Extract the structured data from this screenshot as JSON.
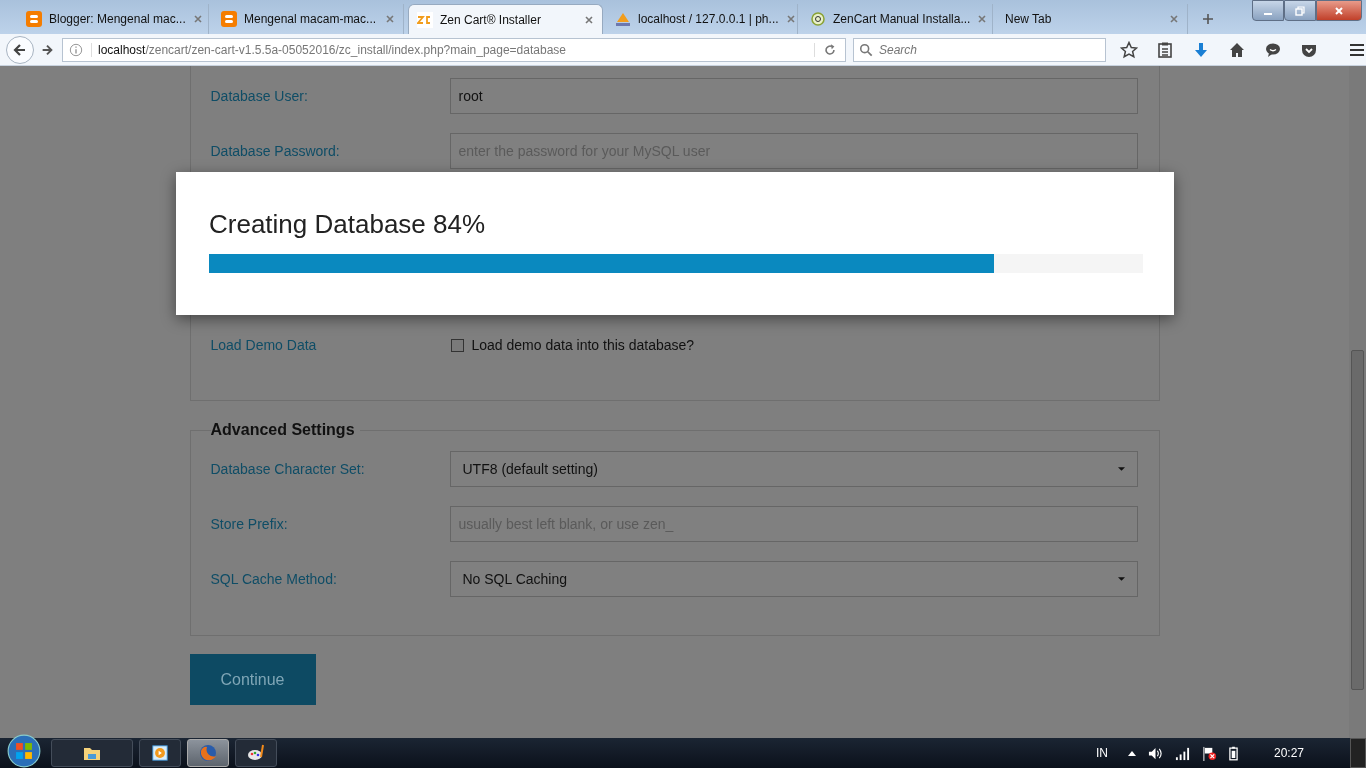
{
  "browser": {
    "tabs": [
      {
        "kind": "blogger",
        "label": "Blogger: Mengenal mac...",
        "selected": false
      },
      {
        "kind": "blogger",
        "label": "Mengenal macam-mac...",
        "selected": false
      },
      {
        "kind": "zencart",
        "label": "Zen Cart® Installer",
        "selected": true
      },
      {
        "kind": "pma",
        "label": "localhost / 127.0.0.1 | ph...",
        "selected": false
      },
      {
        "kind": "manual",
        "label": "ZenCart Manual Installa...",
        "selected": false
      },
      {
        "kind": "blank",
        "label": "New Tab",
        "selected": false
      }
    ],
    "url_host": "localhost",
    "url_path": "/zencart/zen-cart-v1.5.5a-05052016/zc_install/index.php?main_page=database",
    "search": {
      "placeholder": "Search"
    }
  },
  "form": {
    "fields": [
      {
        "kind": "text",
        "label": "Database User:",
        "value": "root"
      },
      {
        "kind": "text",
        "label": "Database Password:",
        "placeholder": "enter the password for your MySQL user"
      },
      {
        "kind": "checkbox",
        "label": "Load Demo Data",
        "option": "Load demo data into this database?",
        "checked": false
      }
    ],
    "advanced": {
      "title": "Advanced Settings",
      "fields": [
        {
          "kind": "select",
          "label": "Database Character Set:",
          "value": "UTF8 (default setting)"
        },
        {
          "kind": "text",
          "label": "Store Prefix:",
          "placeholder": "usually best left blank, or use zen_"
        },
        {
          "kind": "select",
          "label": "SQL Cache Method:",
          "value": "No SQL Caching"
        }
      ]
    },
    "continue_button": "Continue"
  },
  "modal": {
    "title": "Creating Database 84%",
    "level": 0.84
  },
  "taskbar": {
    "items": [
      {
        "kind": "explorer",
        "selected": false
      },
      {
        "kind": "media",
        "selected": false
      },
      {
        "kind": "firefox",
        "selected": true
      },
      {
        "kind": "paint",
        "selected": false
      }
    ],
    "language": "IN",
    "time": "20:27"
  }
}
